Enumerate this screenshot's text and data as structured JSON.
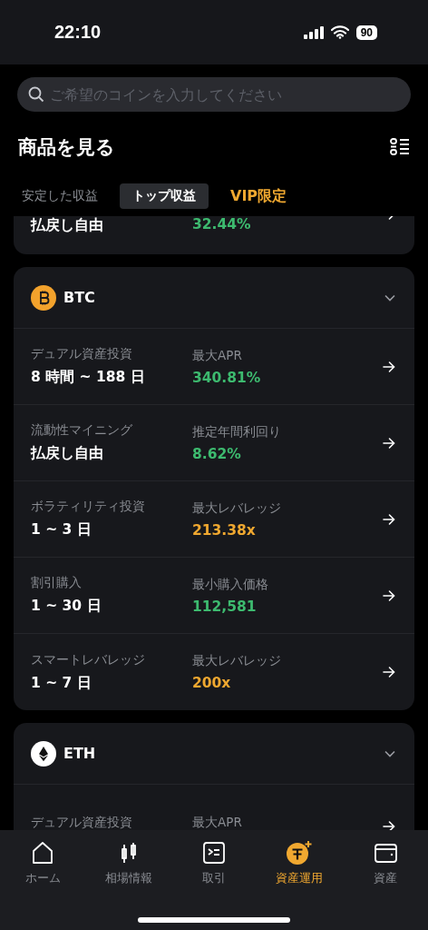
{
  "status_bar": {
    "time": "22:10",
    "battery": "90"
  },
  "search": {
    "placeholder": "ご希望のコインを入力してください"
  },
  "header": {
    "title": "商品を見る"
  },
  "tabs": [
    {
      "label": "安定した収益",
      "selected": false,
      "kind": "plain"
    },
    {
      "label": "トップ収益",
      "selected": true,
      "kind": "plain"
    },
    {
      "label": "VIP限定",
      "selected": false,
      "kind": "vip"
    }
  ],
  "partial_card": {
    "value": "払戻し自由",
    "metric_value": "32.44%",
    "color": "#3dba6f"
  },
  "coins": [
    {
      "symbol": "BTC",
      "kind": "btc",
      "expanded": true,
      "products": [
        {
          "name": "デュアル資産投資",
          "value": "8 時間 ~ 188 日",
          "metric": "最大APR",
          "metric_value": "340.81%",
          "color": "#3dba6f"
        },
        {
          "name": "流動性マイニング",
          "value": "払戻し自由",
          "metric": "推定年間利回り",
          "metric_value": "8.62%",
          "color": "#3dba6f"
        },
        {
          "name": "ボラティリティ投資",
          "value": "1 ~ 3 日",
          "metric": "最大レバレッジ",
          "metric_value": "213.38x",
          "color": "#f0a830"
        },
        {
          "name": "割引購入",
          "value": "1 ~ 30 日",
          "metric": "最小購入価格",
          "metric_value": "112,581",
          "color": "#3dba6f"
        },
        {
          "name": "スマートレバレッジ",
          "value": "1 ~ 7 日",
          "metric": "最大レバレッジ",
          "metric_value": "200x",
          "color": "#f0a830"
        }
      ]
    },
    {
      "symbol": "ETH",
      "kind": "eth",
      "expanded": true,
      "products": [
        {
          "name": "デュアル資産投資",
          "metric": "最大APR"
        }
      ]
    }
  ],
  "nav": [
    {
      "label": "ホーム",
      "kind": "home",
      "selected": false
    },
    {
      "label": "相場情報",
      "kind": "market",
      "selected": false
    },
    {
      "label": "取引",
      "kind": "trade",
      "selected": false
    },
    {
      "label": "資産運用",
      "kind": "earn",
      "selected": true
    },
    {
      "label": "資産",
      "kind": "wallet",
      "selected": false
    }
  ]
}
